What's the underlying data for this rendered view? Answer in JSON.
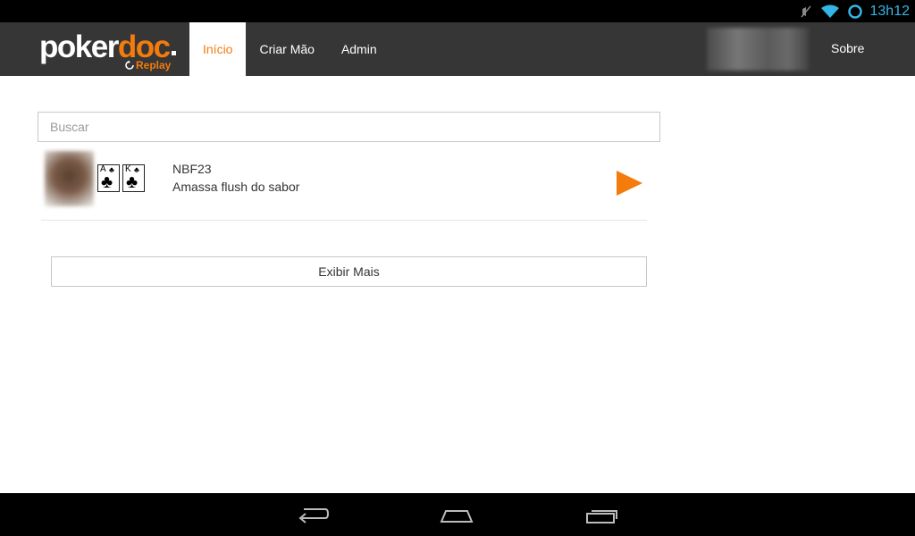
{
  "status_bar": {
    "time": "13h12",
    "icons": [
      "muted-icon",
      "wifi-icon",
      "sync-icon"
    ]
  },
  "header": {
    "logo": {
      "text_part1": "poker",
      "text_part2": "doc",
      "sub": "Replay"
    },
    "nav": [
      {
        "label": "Início",
        "active": true
      },
      {
        "label": "Criar Mão",
        "active": false
      },
      {
        "label": "Admin",
        "active": false
      }
    ],
    "about": "Sobre"
  },
  "search": {
    "placeholder": "Buscar",
    "value": ""
  },
  "hands": [
    {
      "title": "NBF23",
      "description": "Amassa flush do sabor",
      "cards": [
        {
          "rank": "A",
          "suit": "♣"
        },
        {
          "rank": "K",
          "suit": "♣"
        }
      ]
    }
  ],
  "show_more_label": "Exibir Mais",
  "colors": {
    "accent": "#f47b0c",
    "header_bg": "#363636",
    "status_clock": "#33b5e5"
  }
}
